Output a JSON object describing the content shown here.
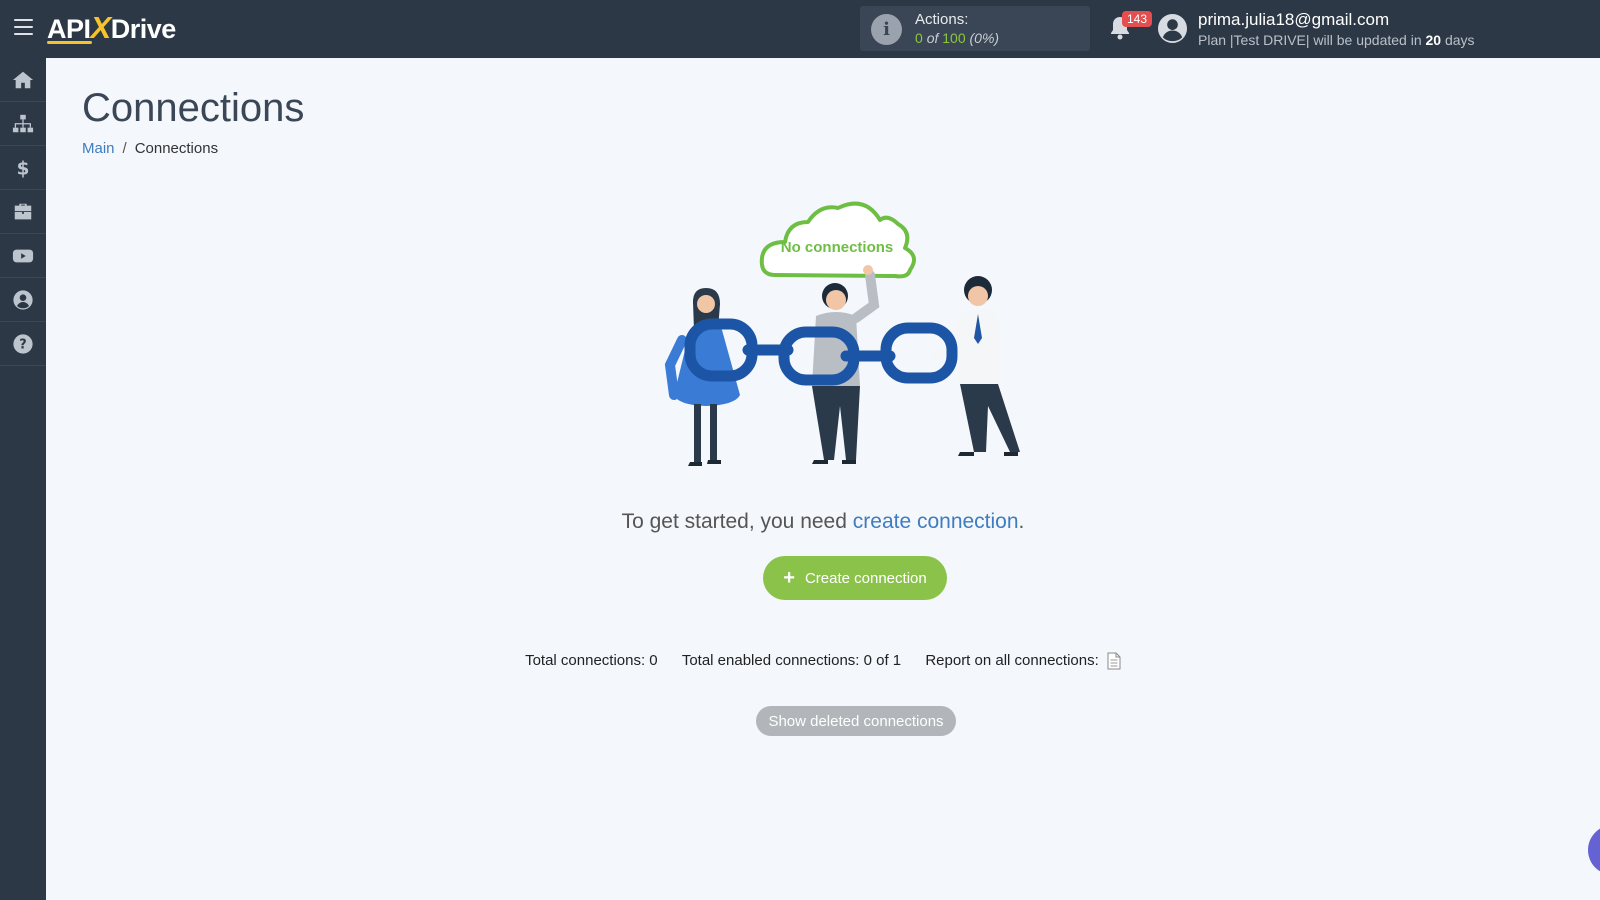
{
  "app": {
    "logo_prefix": "API",
    "logo_x": "X",
    "logo_suffix": "Drive"
  },
  "header": {
    "actions_label": "Actions:",
    "actions_used": "0",
    "actions_of": "of",
    "actions_total": "100",
    "actions_percent": "(0%)",
    "notifications_count": "143",
    "user_email": "prima.julia18@gmail.com",
    "plan_text": "Plan |Test DRIVE| will be updated in",
    "plan_days": "20",
    "plan_days_suffix": "days"
  },
  "sidebar": {
    "items": [
      {
        "icon": "home-icon"
      },
      {
        "icon": "sitemap-icon"
      },
      {
        "icon": "dollar-icon"
      },
      {
        "icon": "briefcase-icon"
      },
      {
        "icon": "youtube-icon"
      },
      {
        "icon": "user-circle-icon"
      },
      {
        "icon": "question-circle-icon"
      }
    ]
  },
  "main": {
    "title": "Connections",
    "breadcrumb": {
      "root": "Main",
      "separator": "/",
      "current": "Connections"
    },
    "illustration_text": "No connections",
    "get_started_prefix": "To get started, you need",
    "get_started_link": "create connection",
    "get_started_suffix": ".",
    "create_button": "Create connection",
    "stats": {
      "total": "Total connections: 0",
      "enabled": "Total enabled connections: 0 of 1",
      "report": "Report on all connections:"
    },
    "show_deleted_button": "Show deleted connections"
  },
  "colors": {
    "topbar": "#2d3846",
    "accent_green": "#8bc34a",
    "link_blue": "#3f7cc0",
    "badge_red": "#e54e4e",
    "logo_yellow": "#f6c32a"
  }
}
